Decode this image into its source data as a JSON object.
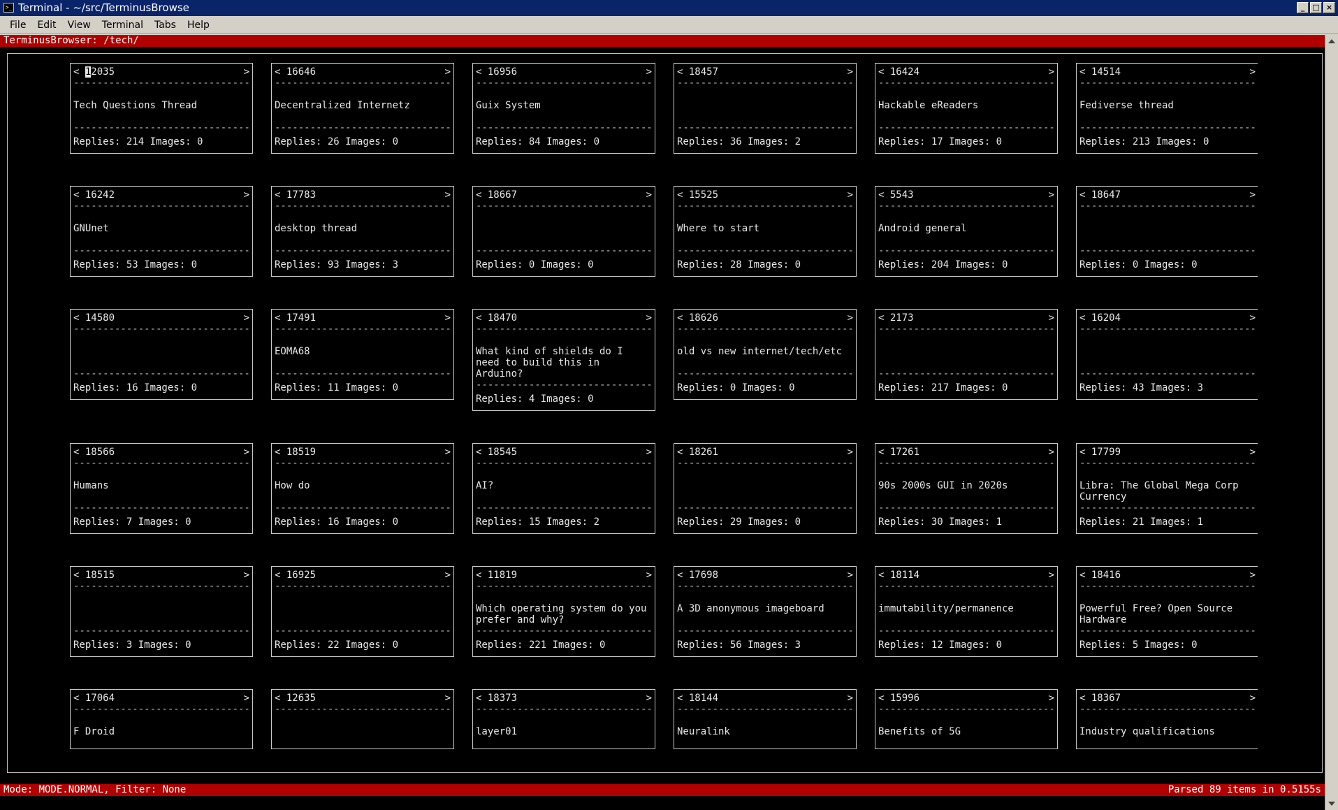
{
  "window": {
    "title": "Terminal - ~/src/TerminusBrowse",
    "icon": "terminal-icon",
    "controls": [
      "minimize",
      "maximize",
      "close"
    ]
  },
  "menu": [
    "File",
    "Edit",
    "View",
    "Terminal",
    "Tabs",
    "Help"
  ],
  "header": "TerminusBrowser: /tech/",
  "footer": {
    "left": "Mode: MODE.NORMAL, Filter: None",
    "right": "Parsed 89 items in 0.5155s"
  },
  "colors": {
    "bar": "#b00000",
    "terminal_bg": "#000000",
    "title_bg": "#0a246a"
  },
  "rows": [
    [
      {
        "id": "12035",
        "title": "Tech Questions Thread",
        "stats": "Replies: 214 Images: 0"
      },
      {
        "id": "16646",
        "title": "Decentralized Internetz",
        "stats": "Replies: 26 Images: 0"
      },
      {
        "id": "16956",
        "title": "Guix System",
        "stats": "Replies: 84 Images: 0"
      },
      {
        "id": "18457",
        "title": "",
        "stats": "Replies: 36 Images: 2"
      },
      {
        "id": "16424",
        "title": "Hackable eReaders",
        "stats": "Replies: 17 Images: 0"
      },
      {
        "id": "14514",
        "title": "Fediverse thread",
        "stats": "Replies: 213 Images: 0"
      }
    ],
    [
      {
        "id": "16242",
        "title": "GNUnet",
        "stats": "Replies: 53 Images: 0"
      },
      {
        "id": "17783",
        "title": "desktop thread",
        "stats": "Replies: 93 Images: 3"
      },
      {
        "id": "18667",
        "title": "",
        "stats": "Replies: 0 Images: 0"
      },
      {
        "id": "15525",
        "title": "Where to start",
        "stats": "Replies: 28 Images: 0"
      },
      {
        "id": "5543",
        "title": "Android general",
        "stats": "Replies: 204 Images: 0"
      },
      {
        "id": "18647",
        "title": "",
        "stats": "Replies: 0 Images: 0"
      }
    ],
    [
      {
        "id": "14580",
        "title": "",
        "stats": "Replies: 16 Images: 0"
      },
      {
        "id": "17491",
        "title": "EOMA68",
        "stats": "Replies: 11 Images: 0"
      },
      {
        "id": "18470",
        "title": "What kind of shields do I need to build this in Arduino?",
        "stats": "Replies: 4 Images: 0"
      },
      {
        "id": "18626",
        "title": "old vs new internet/tech/etc",
        "stats": "Replies: 0 Images: 0"
      },
      {
        "id": "2173",
        "title": "",
        "stats": "Replies: 217 Images: 0"
      },
      {
        "id": "16204",
        "title": "",
        "stats": "Replies: 43 Images: 3"
      }
    ],
    [
      {
        "id": "18566",
        "title": "Humans",
        "stats": "Replies: 7 Images: 0"
      },
      {
        "id": "18519",
        "title": "How do",
        "stats": "Replies: 16 Images: 0"
      },
      {
        "id": "18545",
        "title": "AI?",
        "stats": "Replies: 15 Images: 2"
      },
      {
        "id": "18261",
        "title": "",
        "stats": "Replies: 29 Images: 0"
      },
      {
        "id": "17261",
        "title": "90s 2000s GUI in 2020s",
        "stats": "Replies: 30 Images: 1"
      },
      {
        "id": "17799",
        "title": "Libra: The Global Mega Corp Currency",
        "stats": "Replies: 21 Images: 1"
      }
    ],
    [
      {
        "id": "18515",
        "title": "",
        "stats": "Replies: 3 Images: 0"
      },
      {
        "id": "16925",
        "title": "",
        "stats": "Replies: 22 Images: 0"
      },
      {
        "id": "11819",
        "title": "Which operating system do you prefer and why?",
        "stats": "Replies: 221 Images: 0"
      },
      {
        "id": "17698",
        "title": "A 3D anonymous imageboard",
        "stats": "Replies: 56 Images: 3"
      },
      {
        "id": "18114",
        "title": "immutability/permanence",
        "stats": "Replies: 12 Images: 0"
      },
      {
        "id": "18416",
        "title": "Powerful Free? Open Source Hardware",
        "stats": "Replies: 5 Images: 0"
      }
    ],
    [
      {
        "id": "17064",
        "title": "F Droid",
        "stats": ""
      },
      {
        "id": "12635",
        "title": "",
        "stats": ""
      },
      {
        "id": "18373",
        "title": "layer01",
        "stats": ""
      },
      {
        "id": "18144",
        "title": "Neuralink",
        "stats": ""
      },
      {
        "id": "15996",
        "title": "Benefits of 5G",
        "stats": ""
      },
      {
        "id": "18367",
        "title": "Industry qualifications",
        "stats": ""
      }
    ]
  ]
}
